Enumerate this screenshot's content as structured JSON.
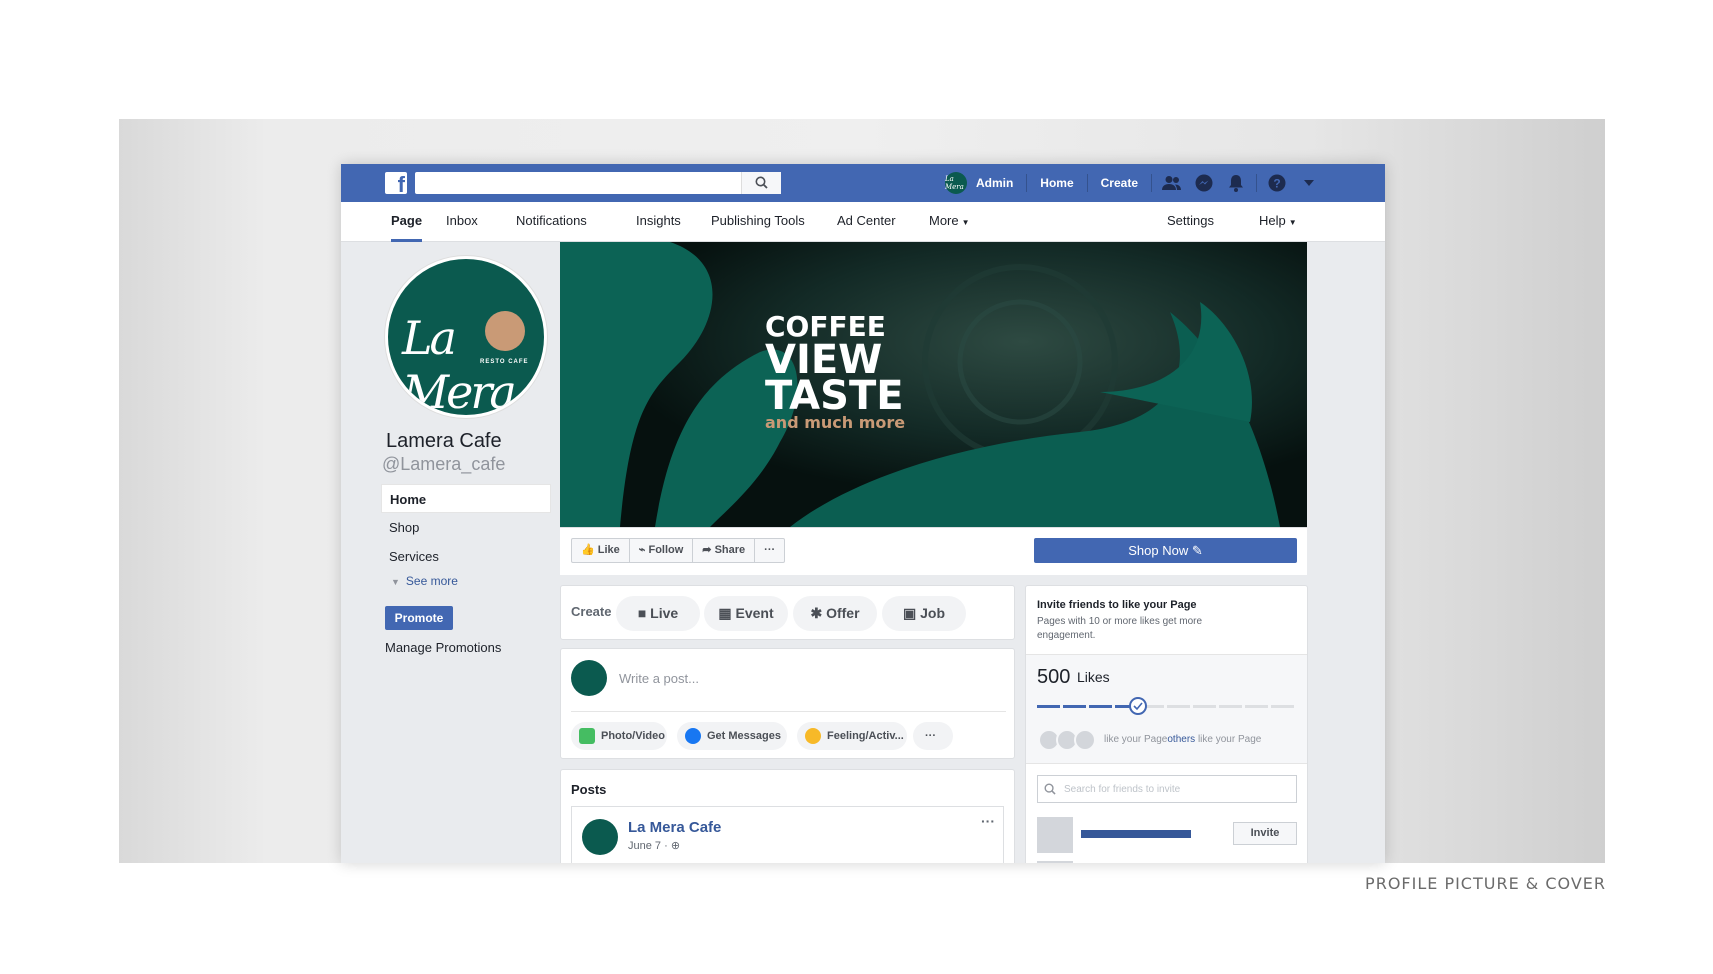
{
  "caption": "PROFILE PICTURE & COVER",
  "topbar": {
    "logo": "f",
    "admin_label": "Admin",
    "admin_avatar_text": "La Mera",
    "home": "Home",
    "create": "Create"
  },
  "pagenav": {
    "items": [
      "Page",
      "Inbox",
      "Notifications",
      "Insights",
      "Publishing Tools",
      "Ad Center",
      "More"
    ],
    "settings": "Settings",
    "help": "Help"
  },
  "profile": {
    "logo_text": "La Mera",
    "logo_sub": "RESTO CAFE",
    "name": "Lamera Cafe",
    "handle": "@Lamera_cafe"
  },
  "leftnav": {
    "items": [
      "Home",
      "Shop",
      "Services"
    ],
    "see_more": "See more",
    "promote": "Promote",
    "manage": "Manage Promotions"
  },
  "cover": {
    "line1": "COFFEE",
    "line2": "VIEW",
    "line3": "TASTE",
    "line4": "and much more"
  },
  "actions": {
    "like": "Like",
    "follow": "Follow",
    "share": "Share",
    "more": "···",
    "shop_now": "Shop Now"
  },
  "create_bar": {
    "label": "Create",
    "live": "Live",
    "event": "Event",
    "offer": "Offer",
    "job": "Job"
  },
  "composer": {
    "placeholder": "Write a post...",
    "photo_video": "Photo/Video",
    "get_messages": "Get Messages",
    "feeling": "Feeling/Activ...",
    "more": "···"
  },
  "posts": {
    "title": "Posts",
    "author": "La Mera Cafe",
    "date": "June 7 · ",
    "menu": "···"
  },
  "invite": {
    "title": "Invite friends to like your Page",
    "desc": "Pages with 10 or more likes get more engagement.",
    "likes_count": "500",
    "likes_label": "Likes",
    "progress_fraction": 0.42,
    "line_a": "like your Page",
    "line_b": "others",
    "line_c": " like your Page",
    "search_placeholder": "Search for friends to invite",
    "invite_btn": "Invite"
  },
  "colors": {
    "fb_blue": "#4267b2",
    "brand_green": "#0b5a4f",
    "brand_copper": "#c99a76"
  }
}
